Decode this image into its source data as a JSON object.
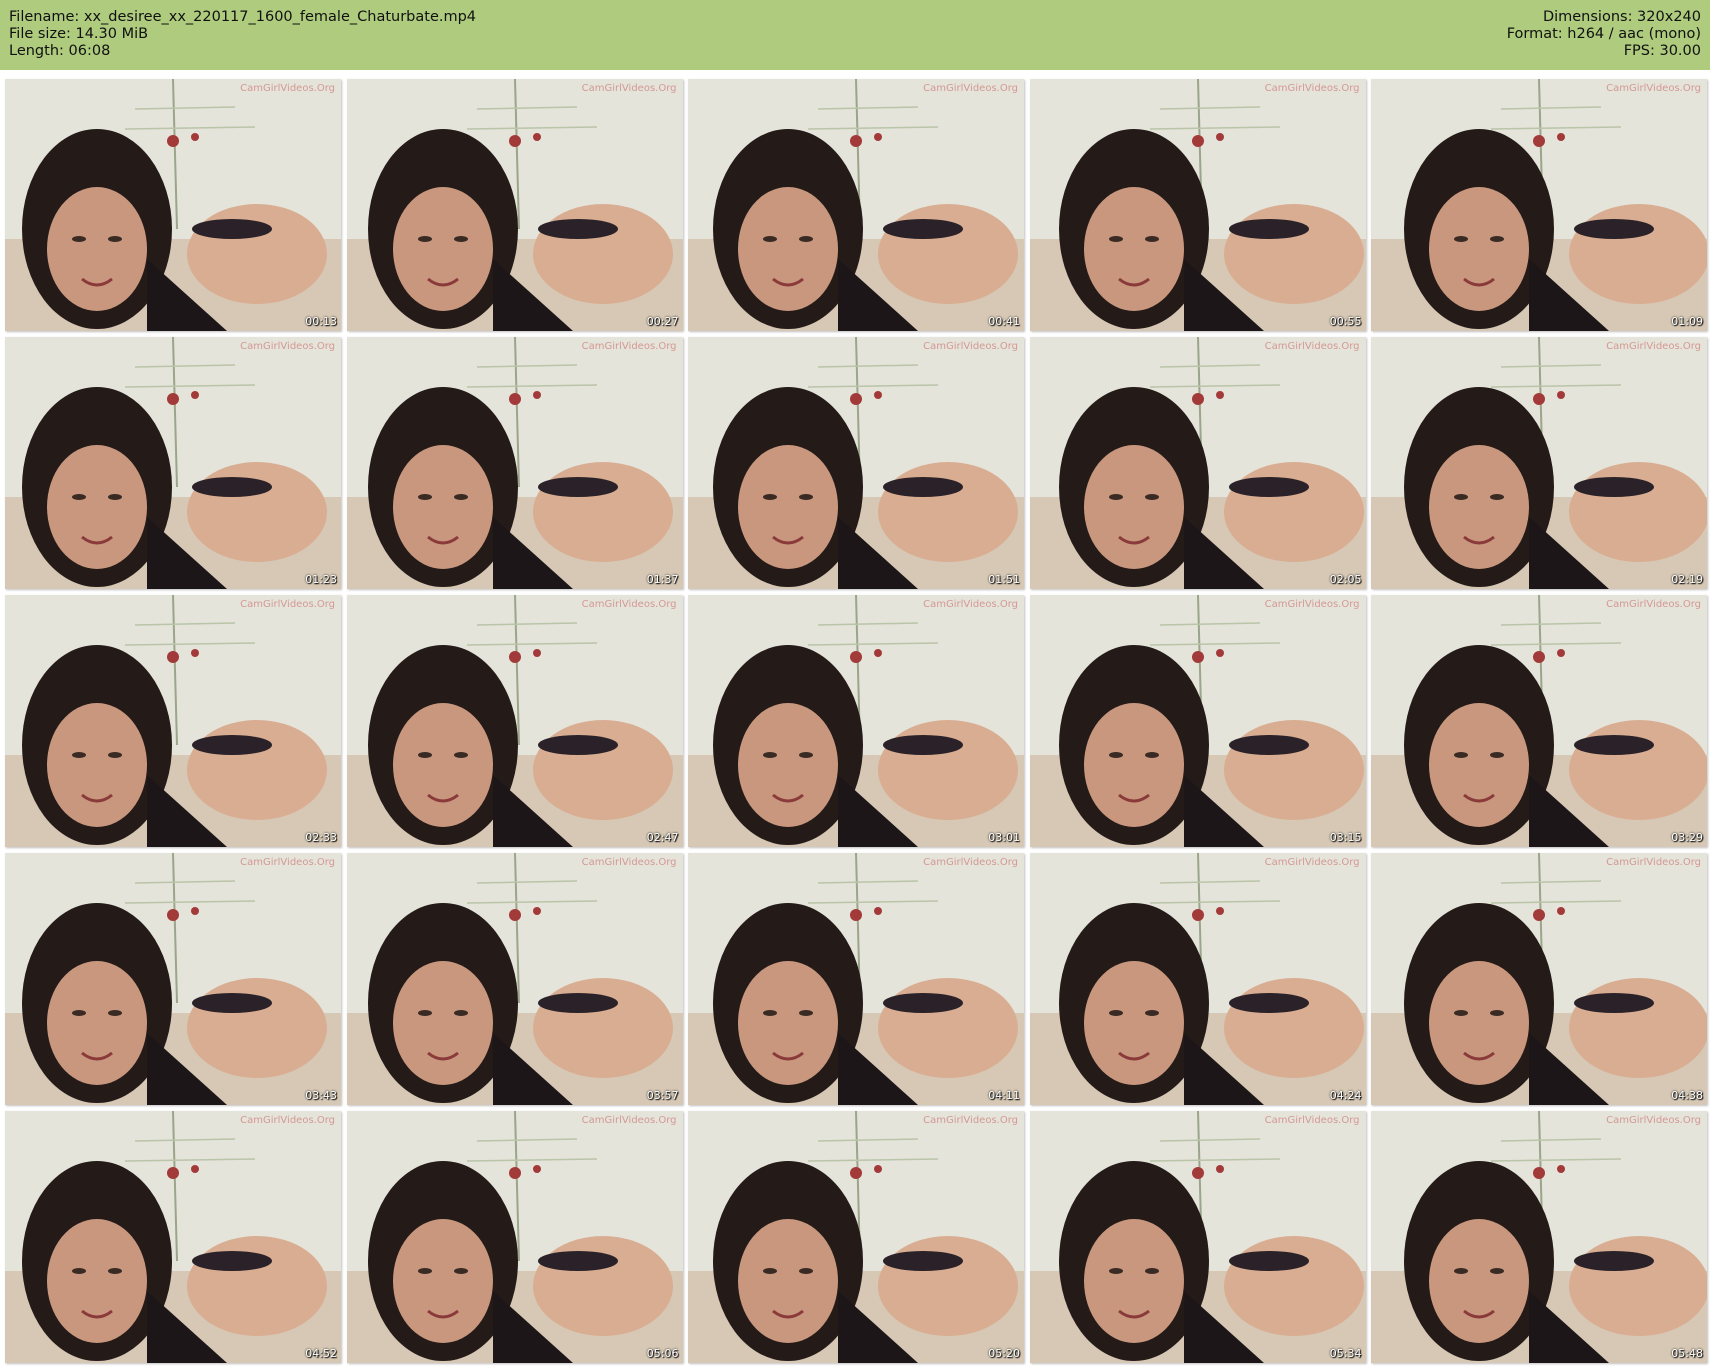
{
  "header": {
    "filename": "Filename: xx_desiree_xx_220117_1600_female_Chaturbate.mp4",
    "filesize": "File size: 14.30 MiB",
    "length": "Length: 06:08",
    "dimensions": "Dimensions: 320x240",
    "format": "Format: h264 / aac (mono)",
    "fps": "FPS: 30.00"
  },
  "colors": {
    "header_bg": "#aecb7e",
    "page_bg": "#ffffff"
  },
  "watermark": "CamGirlVideos.Org",
  "thumbnails": [
    {
      "time": "00:13"
    },
    {
      "time": "00:27"
    },
    {
      "time": "00:41"
    },
    {
      "time": "00:55"
    },
    {
      "time": "01:09"
    },
    {
      "time": "01:23"
    },
    {
      "time": "01:37"
    },
    {
      "time": "01:51"
    },
    {
      "time": "02:05"
    },
    {
      "time": "02:19"
    },
    {
      "time": "02:33"
    },
    {
      "time": "02:47"
    },
    {
      "time": "03:01"
    },
    {
      "time": "03:15"
    },
    {
      "time": "03:29"
    },
    {
      "time": "03:43"
    },
    {
      "time": "03:57"
    },
    {
      "time": "04:11"
    },
    {
      "time": "04:24"
    },
    {
      "time": "04:38"
    },
    {
      "time": "04:52"
    },
    {
      "time": "05:06"
    },
    {
      "time": "05:20"
    },
    {
      "time": "05:34"
    },
    {
      "time": "05:48"
    }
  ]
}
